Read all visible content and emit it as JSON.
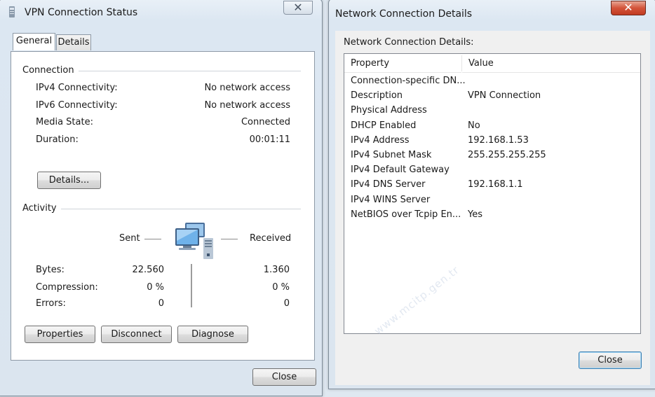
{
  "vpn_window": {
    "title": "VPN Connection Status",
    "tabs": [
      {
        "label": "General",
        "active": true
      },
      {
        "label": "Details",
        "active": false
      }
    ],
    "connection": {
      "heading": "Connection",
      "rows": [
        {
          "label": "IPv4 Connectivity:",
          "value": "No network access"
        },
        {
          "label": "IPv6 Connectivity:",
          "value": "No network access"
        },
        {
          "label": "Media State:",
          "value": "Connected"
        },
        {
          "label": "Duration:",
          "value": "00:01:11"
        }
      ],
      "details_button": "Details..."
    },
    "activity": {
      "heading": "Activity",
      "sent_label": "Sent",
      "received_label": "Received",
      "rows": [
        {
          "label": "Bytes:",
          "sent": "22.560",
          "received": "1.360"
        },
        {
          "label": "Compression:",
          "sent": "0 %",
          "received": "0 %"
        },
        {
          "label": "Errors:",
          "sent": "0",
          "received": "0"
        }
      ]
    },
    "buttons": {
      "properties": "Properties",
      "disconnect": "Disconnect",
      "diagnose": "Diagnose",
      "close": "Close"
    }
  },
  "details_window": {
    "title": "Network Connection Details",
    "caption": "Network Connection Details:",
    "columns": {
      "property": "Property",
      "value": "Value"
    },
    "rows": [
      {
        "property": "Connection-specific DN...",
        "value": ""
      },
      {
        "property": "Description",
        "value": "VPN Connection"
      },
      {
        "property": "Physical Address",
        "value": ""
      },
      {
        "property": "DHCP Enabled",
        "value": "No"
      },
      {
        "property": "IPv4 Address",
        "value": "192.168.1.53"
      },
      {
        "property": "IPv4 Subnet Mask",
        "value": "255.255.255.255"
      },
      {
        "property": "IPv4 Default Gateway",
        "value": ""
      },
      {
        "property": "IPv4 DNS Server",
        "value": "192.168.1.1"
      },
      {
        "property": "IPv4 WINS Server",
        "value": ""
      },
      {
        "property": "NetBIOS over Tcpip En...",
        "value": "Yes"
      }
    ],
    "close_button": "Close"
  },
  "watermark": "www.mcitp.gen.tr",
  "colors": {
    "desktop": "#dfe8f1",
    "window_frame": "#dbe5ef",
    "close_red": "#c23b21"
  }
}
